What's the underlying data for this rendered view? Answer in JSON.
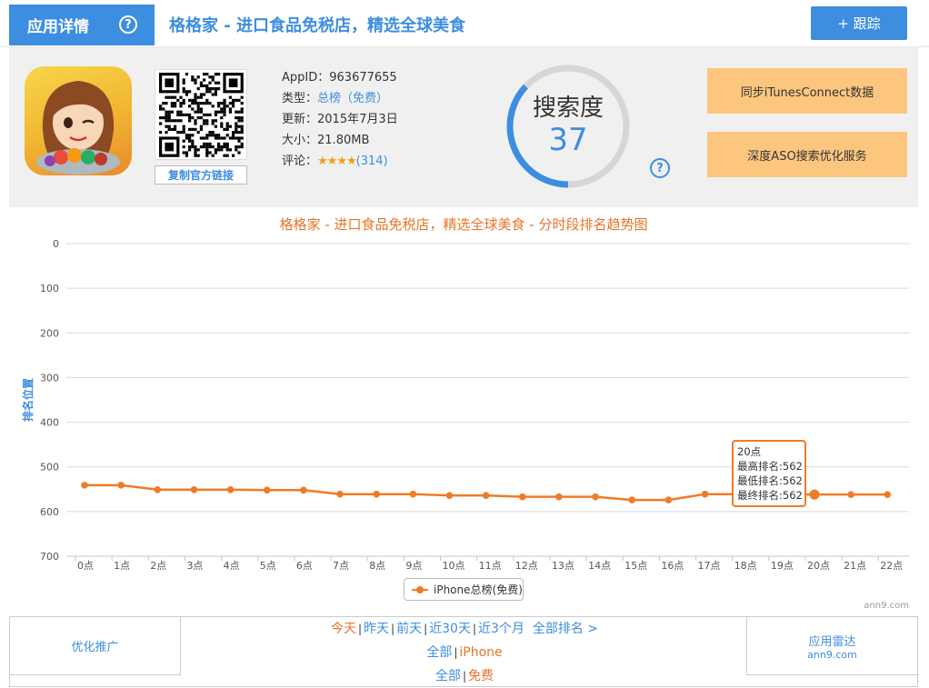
{
  "header": {
    "section_label": "应用详情",
    "help_icon_glyph": "?",
    "app_title": "格格家 - 进口食品免税店，精选全球美食",
    "track_button": "+ 跟踪"
  },
  "app": {
    "copy_link": "复制官方链接",
    "appid_label": "AppID：",
    "appid": "963677655",
    "type_label": "类型：",
    "type": "总榜（免费）",
    "updated_label": "更新：",
    "updated": "2015年7月3日",
    "size_label": "大小：",
    "size": "21.80MB",
    "rating_label": "评论：",
    "stars": "★★★★",
    "reviews": "(314)"
  },
  "search_index": {
    "label": "搜索度",
    "value": "37",
    "fraction": 0.37
  },
  "actions": {
    "sync_itunes": "同步iTunesConnect数据",
    "aso_service": "深度ASO搜索优化服务"
  },
  "colors": {
    "accent": "#3d8ee0",
    "series": "#f07b26",
    "button_orange": "#fdc67f"
  },
  "chart_data": {
    "type": "line",
    "title": "格格家 - 进口食品免税店，精选全球美食 - 分时段排名趋势图",
    "ylabel": "排名位置",
    "xlabel": "",
    "ylim": [
      0,
      700
    ],
    "y_reversed": true,
    "yticks": [
      "0",
      "100",
      "200",
      "300",
      "400",
      "500",
      "600",
      "700"
    ],
    "categories": [
      "0点",
      "1点",
      "2点",
      "3点",
      "4点",
      "5点",
      "6点",
      "7点",
      "8点",
      "9点",
      "10点",
      "11点",
      "12点",
      "13点",
      "14点",
      "15点",
      "16点",
      "17点",
      "18点",
      "19点",
      "20点",
      "21点",
      "22点"
    ],
    "series": [
      {
        "name": "iPhone总榜(免费)",
        "values": [
          541,
          541,
          551,
          551,
          551,
          552,
          552,
          561,
          561,
          561,
          564,
          564,
          567,
          567,
          567,
          574,
          574,
          561,
          561,
          561,
          562,
          562,
          562
        ]
      }
    ],
    "grid": true,
    "legend_position": "bottom-center",
    "watermark": "ann9.com",
    "tooltip": {
      "index": 20,
      "title": "20点",
      "lines": [
        "最高排名:562",
        "最低排名:562",
        "最终排名:562"
      ]
    }
  },
  "footer": {
    "left_label": "优化推广",
    "range_links": [
      "今天",
      "昨天",
      "前天",
      "近30天",
      "近3个月"
    ],
    "all_rankings": "全部排名 >",
    "device_all": "全部",
    "device_iphone": "iPhone",
    "price_all": "全部",
    "price_free": "免费",
    "radar_title": "应用雷达",
    "radar_sub": "ann9.com"
  }
}
